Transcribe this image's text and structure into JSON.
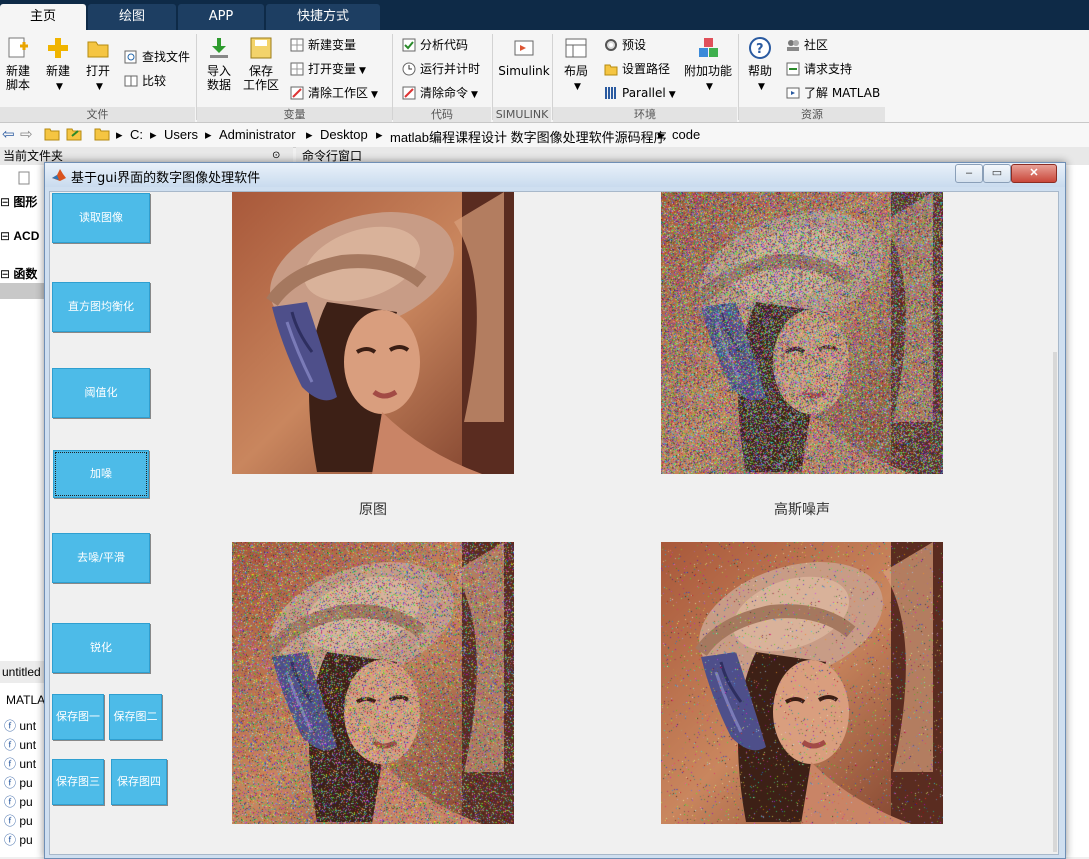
{
  "ribbon": {
    "tabs": [
      {
        "label": "主页",
        "active": true
      },
      {
        "label": "绘图",
        "active": false
      },
      {
        "label": "APP",
        "active": false
      },
      {
        "label": "快捷方式",
        "active": false
      }
    ],
    "file": {
      "new_script": "新建\n脚本",
      "new": "新建",
      "open": "打开",
      "find_files": "查找文件",
      "compare": "比较",
      "label": "文件"
    },
    "variable": {
      "import_data": "导入\n数据",
      "save_workspace": "保存\n工作区",
      "new_variable": "新建变量",
      "open_variable": "打开变量",
      "clear_workspace": "清除工作区",
      "label": "变量"
    },
    "code": {
      "analyze_code": "分析代码",
      "run_and_time": "运行并计时",
      "clear_commands": "清除命令",
      "label": "代码"
    },
    "simulink": {
      "button": "Simulink",
      "label": "SIMULINK"
    },
    "environment": {
      "layout": "布局",
      "preferences": "预设",
      "set_path": "设置路径",
      "parallel": "Parallel",
      "addons": "附加功能",
      "label": "环境"
    },
    "resources": {
      "help": "帮助",
      "community": "社区",
      "request_support": "请求支持",
      "learn_matlab": "了解 MATLAB",
      "label": "资源"
    }
  },
  "address": {
    "path": [
      "C:",
      "Users",
      "Administrator",
      "Desktop",
      "matlab编程课程设计 数字图像处理软件源码程序",
      "code"
    ]
  },
  "panes": {
    "current_folder": "当前文件夹",
    "command_window": "命令行窗口",
    "tree": [
      "图形",
      "ACD",
      "函数"
    ],
    "lower_tab": "untitled",
    "lower_header": "MATLA",
    "file_list": [
      "unt",
      "unt",
      "unt",
      "pu",
      "pu",
      "pu",
      "pu"
    ]
  },
  "figure": {
    "title": "基于gui界面的数字图像处理软件",
    "buttons": {
      "read_image": "读取图像",
      "hist_eq": "直方图均衡化",
      "threshold": "阈值化",
      "add_noise": "加噪",
      "denoise": "去噪/平滑",
      "sharpen": "锐化",
      "save1": "保存图一",
      "save2": "保存图二",
      "save3": "保存图三",
      "save4": "保存图四"
    },
    "captions": {
      "axes1": "原图",
      "axes2": "高斯噪声"
    }
  },
  "colors": {
    "button_bg": "#4dbbe8",
    "ribbon_dark": "#0e2a47"
  }
}
